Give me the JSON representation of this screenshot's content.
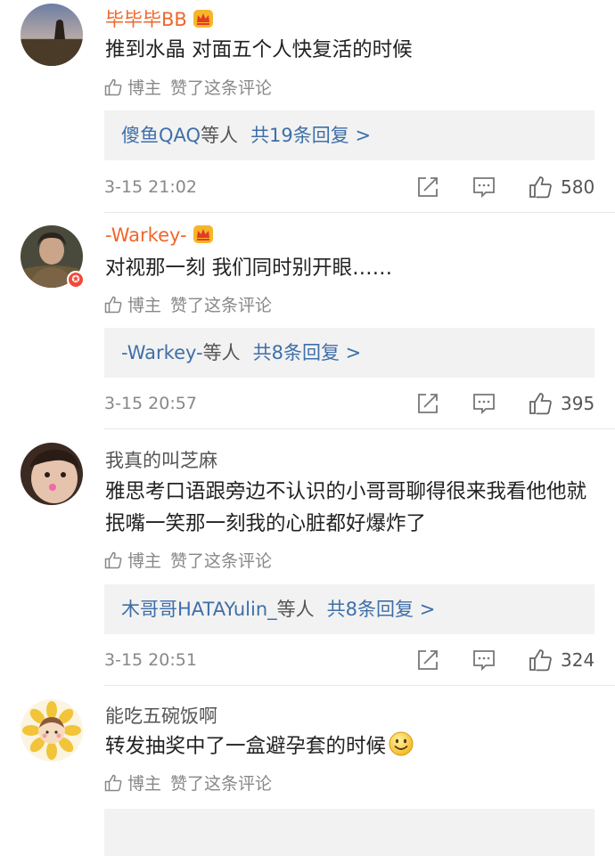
{
  "comments": [
    {
      "username": "毕毕毕BB",
      "text": "推到水晶 对面五个人快复活的时候",
      "liked_by": "博主",
      "liked_text": "赞了这条评论",
      "reply_user": "傻鱼QAQ",
      "reply_suffix": "等人",
      "reply_count": "共19条回复 >",
      "time": "3-15 21:02",
      "likes": "580"
    },
    {
      "username": "-Warkey-",
      "text": "对视那一刻 我们同时别开眼……",
      "liked_by": "博主",
      "liked_text": "赞了这条评论",
      "reply_user": "-Warkey-",
      "reply_suffix": "等人",
      "reply_count": "共8条回复 >",
      "time": "3-15 20:57",
      "likes": "395"
    },
    {
      "username": "我真的叫芝麻",
      "text": "雅思考口语跟旁边不认识的小哥哥聊得很来我看他他就抿嘴一笑那一刻我的心脏都好爆炸了",
      "liked_by": "博主",
      "liked_text": "赞了这条评论",
      "reply_user": "木哥哥HATAYulin_",
      "reply_suffix": "等人",
      "reply_count": "共8条回复 >",
      "time": "3-15 20:51",
      "likes": "324"
    },
    {
      "username": "能吃五碗饭啊",
      "text": "转发抽奖中了一盒避孕套的时候",
      "liked_by": "博主",
      "liked_text": "赞了这条评论"
    }
  ],
  "colors": {
    "vip_name": "#f0662b",
    "link_blue": "#3e6fa8",
    "reply_bg": "#f2f2f2",
    "meta_gray": "#888888"
  },
  "icons": [
    "crown-vip-icon",
    "thumbs-up-icon",
    "share-icon",
    "comment-icon",
    "verified-badge-icon",
    "smile-emoji-icon"
  ]
}
